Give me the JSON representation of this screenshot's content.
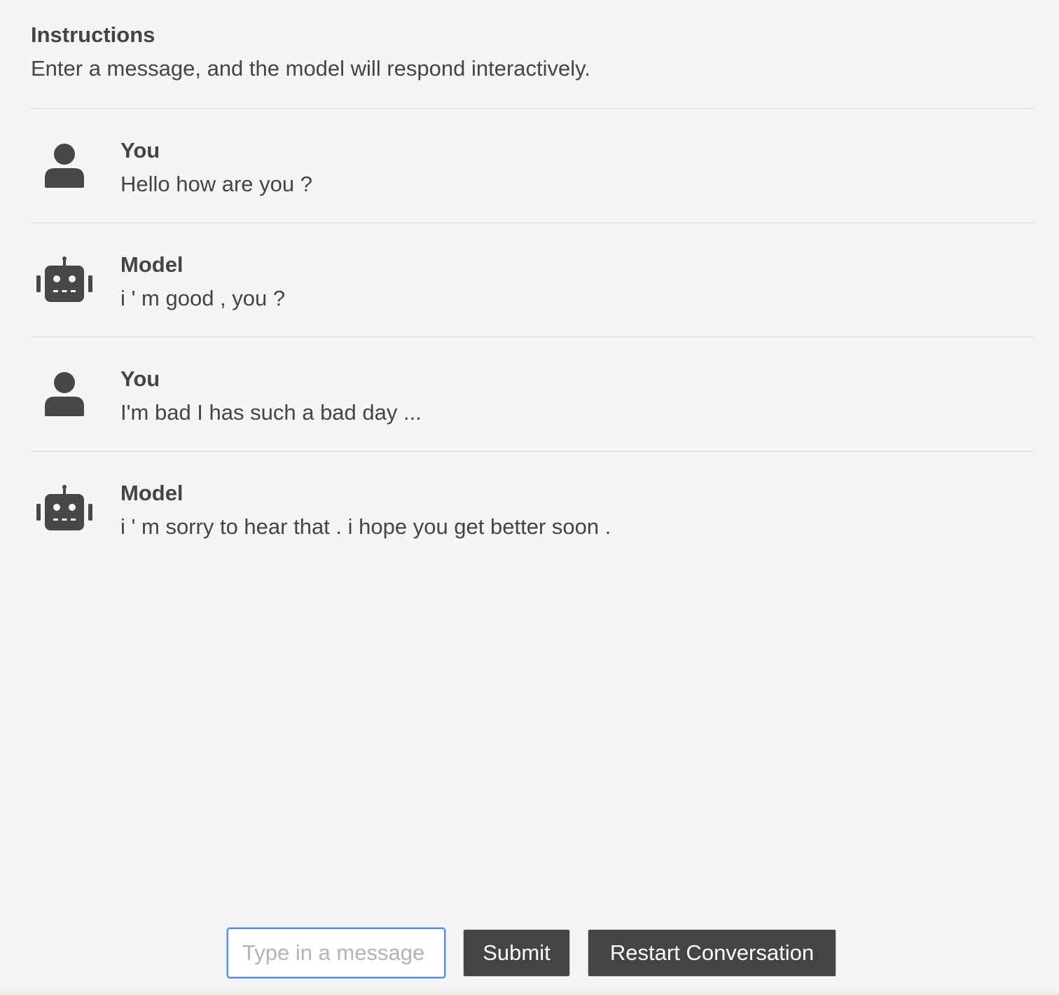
{
  "instructions": {
    "title": "Instructions",
    "text": "Enter a message, and the model will respond interactively."
  },
  "conversation": [
    {
      "sender": "You",
      "role": "user",
      "icon": "person-icon",
      "text": "Hello how are you ?"
    },
    {
      "sender": "Model",
      "role": "model",
      "icon": "robot-icon",
      "text": "i ' m good , you ?"
    },
    {
      "sender": "You",
      "role": "user",
      "icon": "person-icon",
      "text": "I'm bad I has such a bad day ..."
    },
    {
      "sender": "Model",
      "role": "model",
      "icon": "robot-icon",
      "text": "i ' m sorry to hear that . i hope you get better soon ."
    }
  ],
  "input": {
    "placeholder": "Type in a message",
    "value": ""
  },
  "buttons": {
    "submit_label": "Submit",
    "restart_label": "Restart Conversation"
  },
  "colors": {
    "background": "#f5f5f5",
    "text": "#444444",
    "icon": "#474747",
    "button_bg": "#444444",
    "button_text": "#ffffff",
    "input_focus": "#5b8fe0"
  }
}
